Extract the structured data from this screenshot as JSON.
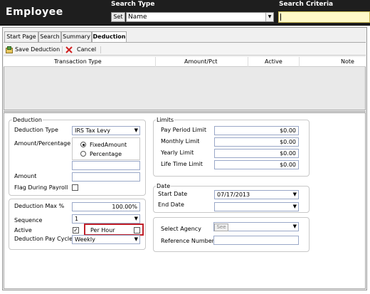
{
  "header": {
    "title": "Employee",
    "search_type_label": "Search Type",
    "search_criteria_label": "Search Criteria",
    "set_label": "Set",
    "search_type_value": "Name",
    "search_criteria_value": ""
  },
  "tabs": [
    {
      "label": "Start Page"
    },
    {
      "label": "Search"
    },
    {
      "label": "Summary"
    },
    {
      "label": "Deduction",
      "active": true
    }
  ],
  "toolbar": {
    "save_label": "Save Deduction",
    "cancel_label": "Cancel"
  },
  "grid": {
    "columns": [
      "Transaction Type",
      "Amount/Pct",
      "Active",
      "Note"
    ],
    "rows": []
  },
  "deduction": {
    "group_title": "Deduction",
    "deduction_type_label": "Deduction Type",
    "deduction_type_value": "IRS Tax Levy",
    "amount_percentage_label": "Amount/Percentage",
    "fixed_amount_label": "FixedAmount",
    "percentage_label": "Percentage",
    "fixed_amount_selected": true,
    "amount_label": "Amount",
    "amount_value": "",
    "flag_during_payroll_label": "Flag During Payroll",
    "flag_during_payroll_checked": false
  },
  "deduction2": {
    "max_label": "Deduction Max %",
    "max_value": "100.00%",
    "sequence_label": "Sequence",
    "sequence_value": "1",
    "active_label": "Active",
    "active_checked": true,
    "per_hour_label": "Per Hour",
    "per_hour_checked": false,
    "pay_cycle_label": "Deduction Pay Cycle",
    "pay_cycle_value": "Weekly"
  },
  "limits": {
    "group_title": "Limits",
    "items": [
      {
        "label": "Pay Period Limit",
        "value": "$0.00"
      },
      {
        "label": "Monthly Limit",
        "value": "$0.00"
      },
      {
        "label": "Yearly Limit",
        "value": "$0.00"
      },
      {
        "label": "Life Time Limit",
        "value": "$0.00"
      }
    ]
  },
  "date": {
    "group_title": "Date",
    "start_label": "Start Date",
    "start_value": "07/17/2013",
    "end_label": "End Date",
    "end_value": ""
  },
  "agency": {
    "select_label": "Select Agency",
    "see_label": "See",
    "agency_value": "",
    "ref_label": "Reference Number",
    "ref_value": ""
  },
  "colors": {
    "header_bg": "#1e1e1e",
    "highlight_border": "#c0202a",
    "criteria_bg": "#fff8c8"
  }
}
